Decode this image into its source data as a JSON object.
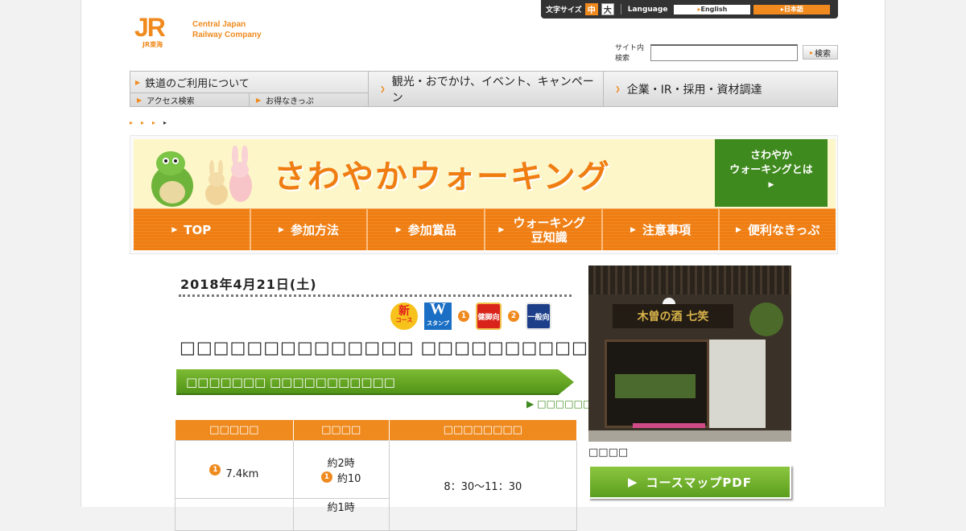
{
  "util": {
    "font_size_label": "文字サイズ",
    "size_mid": "中",
    "size_big": "大",
    "language_label": "Language",
    "english": "English",
    "japanese": "日本語"
  },
  "logo": {
    "mark": "JR",
    "mark_sub": "JR東海",
    "name_line1": "Central Japan",
    "name_line2": "Railway Company"
  },
  "search": {
    "label": "サイト内検索",
    "value": "",
    "button": "検索"
  },
  "gnav": {
    "item1": "鉄道のご利用について",
    "item1_sub1": "アクセス検索",
    "item1_sub2": "お得なきっぷ",
    "item2": "観光・おでかけ、イベント、キャンペーン",
    "item3": "企業・IR・採用・資材調達"
  },
  "banner": {
    "title": "さわやかウォーキング",
    "about_line1": "さわやか",
    "about_line2": "ウォーキングとは",
    "nav": [
      "TOP",
      "参加方法",
      "参加賞品",
      "ウォーキング豆知識",
      "注意事項",
      "便利なきっぷ"
    ]
  },
  "event": {
    "date": "2018年4月21日(土)",
    "badge_new": "新",
    "badge_new_sub": "コース",
    "badge_w": "W",
    "badge_w_sub": "スタンプ",
    "level1_num": "1",
    "level1": "健脚向",
    "level2_num": "2",
    "level2": "一般向",
    "title": "□□□□□□□□□□□□□□ □□□□□□□□□□□□□□□□□",
    "subtitle": "□□□□□□□ □□□□□□□□□□□",
    "link": "□□□□□□□□"
  },
  "table": {
    "headers": [
      "□□□□□",
      "□□□□",
      "□□□□□□□□"
    ],
    "row1": {
      "distance_num": "1",
      "distance": "7.4km",
      "time_line1": "約2時",
      "time_num": "1",
      "time_line2": "約10",
      "reception": "8：30～11：30"
    },
    "row2_time": "約1時"
  },
  "aside": {
    "photo_sign": "木曽の酒 七笑",
    "caption": "□□□□",
    "pdf_button": "コースマップPDF"
  }
}
